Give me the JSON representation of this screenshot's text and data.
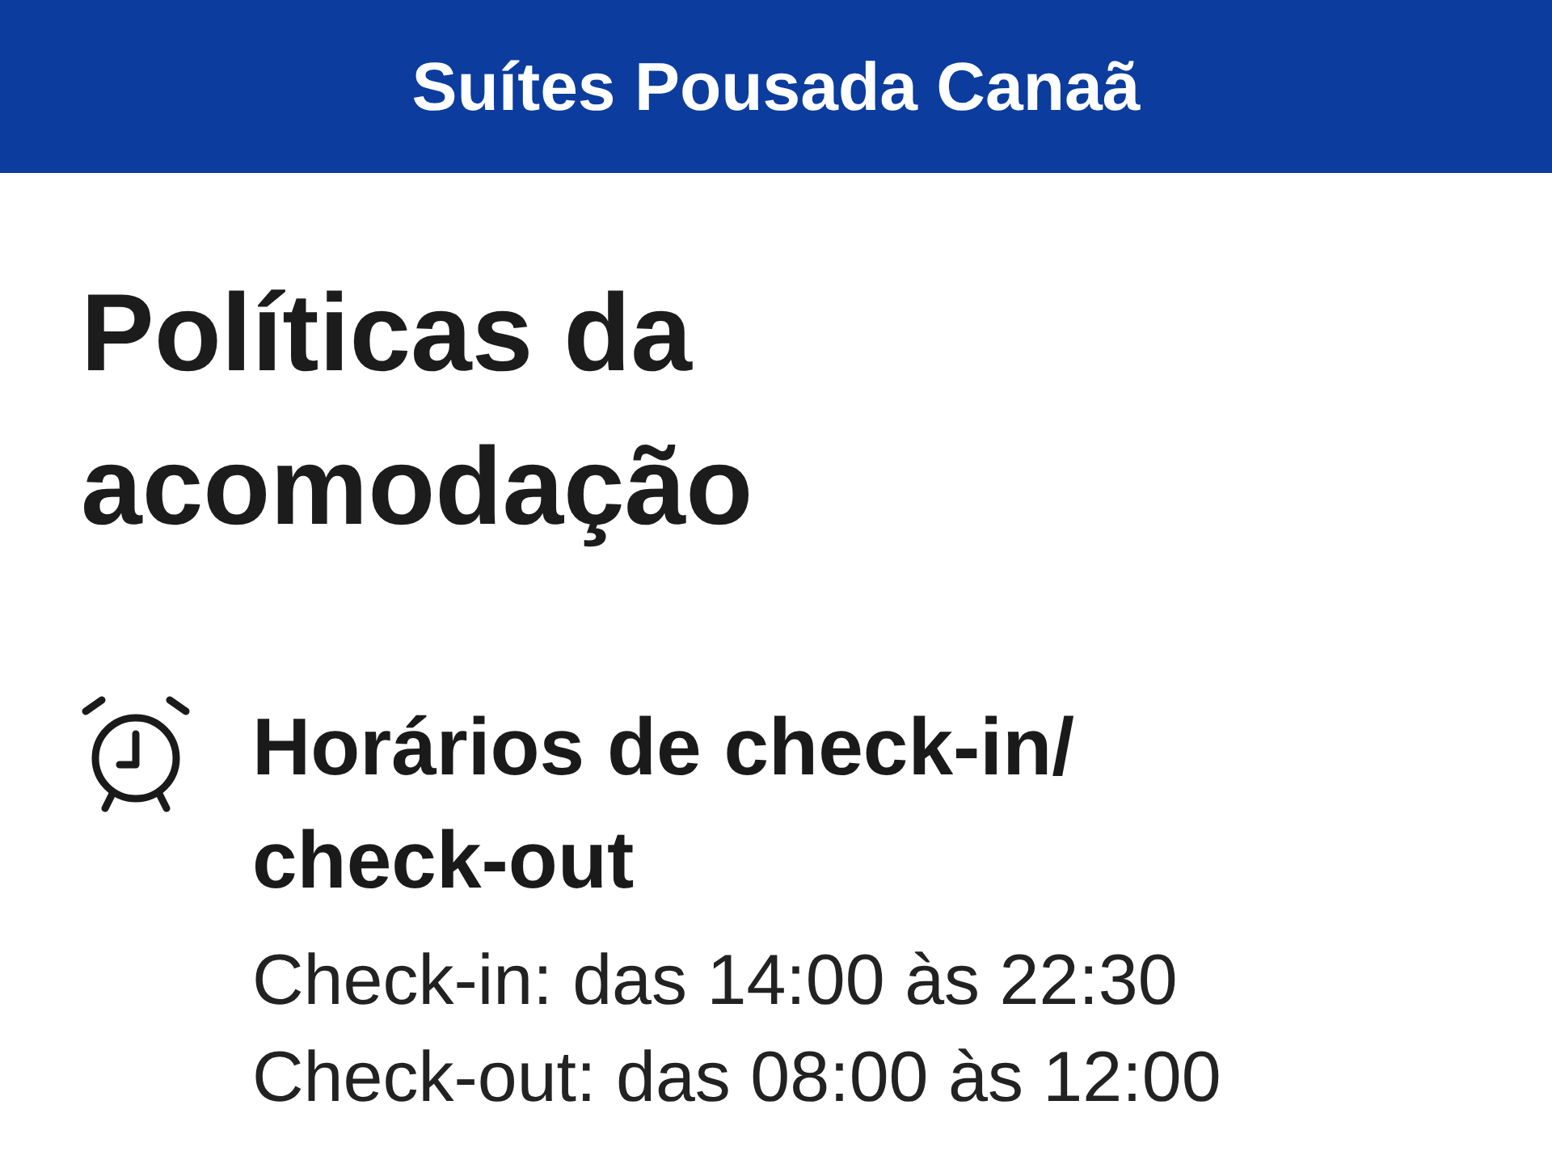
{
  "header": {
    "title": "Suítes Pousada Canaã"
  },
  "heading": "Políticas da acomodação",
  "sections": [
    {
      "title": "Horários de check-in/ check-out",
      "lines": [
        "Check-in: das 14:00 às 22:30",
        "Check-out: das 08:00 às 12:00"
      ]
    }
  ]
}
